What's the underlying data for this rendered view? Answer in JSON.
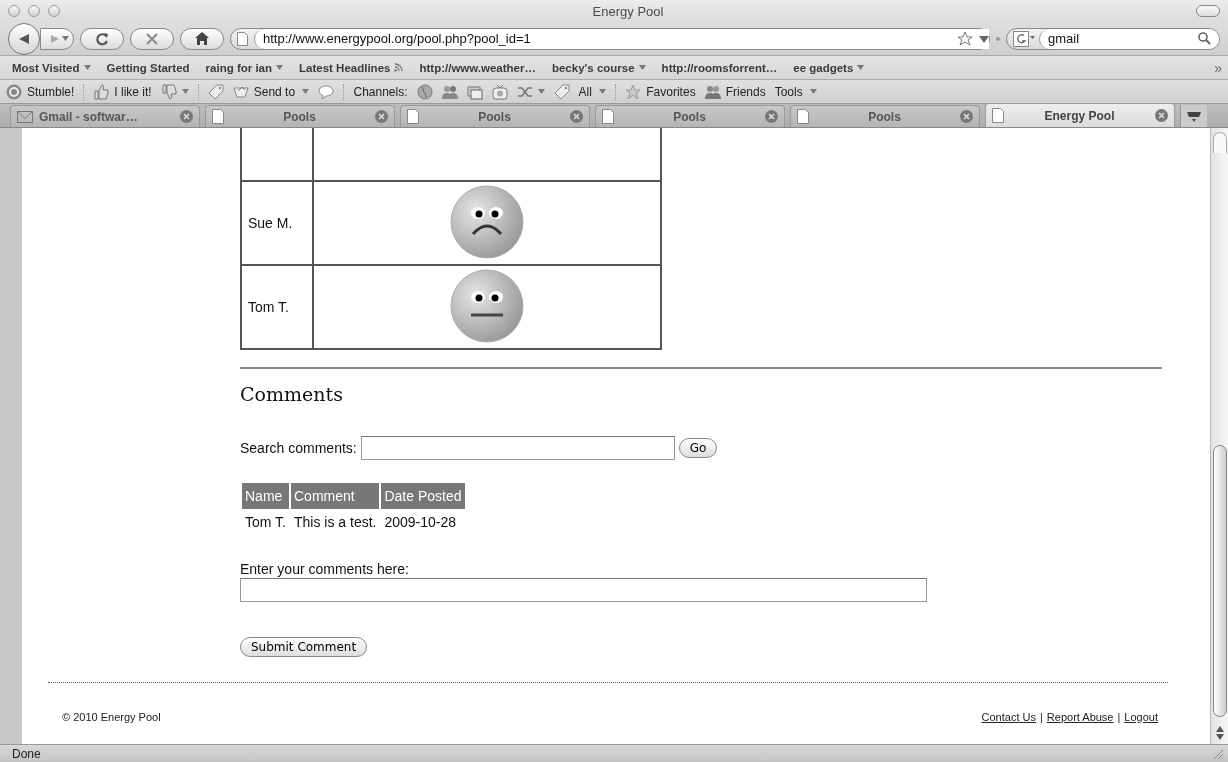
{
  "window": {
    "title": "Energy Pool"
  },
  "navigation": {
    "url": "http://www.energypool.org/pool.php?pool_id=1",
    "search_value": "gmail"
  },
  "bookmarks": {
    "items": [
      {
        "label": "Most Visited",
        "kind": "menu"
      },
      {
        "label": "Getting Started",
        "kind": "link"
      },
      {
        "label": "raing for ian",
        "kind": "menu"
      },
      {
        "label": "Latest Headlines",
        "kind": "feed"
      },
      {
        "label": "http://www.weather…",
        "kind": "link"
      },
      {
        "label": "becky's course",
        "kind": "menu"
      },
      {
        "label": "http://roomsforrent…",
        "kind": "link"
      },
      {
        "label": "ee gadgets",
        "kind": "menu"
      }
    ],
    "overflow": "»"
  },
  "stumble_toolbar": [
    {
      "kind": "stumble",
      "label": "Stumble!"
    },
    {
      "kind": "separator"
    },
    {
      "kind": "like",
      "label": "I like it!"
    },
    {
      "kind": "dislike"
    },
    {
      "kind": "separator"
    },
    {
      "kind": "tag"
    },
    {
      "kind": "send",
      "label": "Send to"
    },
    {
      "kind": "comment"
    },
    {
      "kind": "separator"
    },
    {
      "kind": "channels",
      "label": "Channels:"
    },
    {
      "kind": "globe"
    },
    {
      "kind": "people"
    },
    {
      "kind": "photo"
    },
    {
      "kind": "tv"
    },
    {
      "kind": "shuffle"
    },
    {
      "kind": "tag"
    },
    {
      "kind": "all",
      "label": "All"
    },
    {
      "kind": "separator"
    },
    {
      "kind": "favorites",
      "label": "Favorites"
    },
    {
      "kind": "friends",
      "label": "Friends"
    },
    {
      "kind": "tools",
      "label": "Tools"
    }
  ],
  "tabs": [
    {
      "label": "Gmail - softwar…",
      "kind": "mail",
      "selected": false
    },
    {
      "label": "Pools",
      "kind": "page",
      "selected": false
    },
    {
      "label": "Pools",
      "kind": "page",
      "selected": false
    },
    {
      "label": "Pools",
      "kind": "page",
      "selected": false
    },
    {
      "label": "Pools",
      "kind": "page",
      "selected": false
    },
    {
      "label": "Energy Pool",
      "kind": "page",
      "selected": true
    }
  ],
  "ratings": {
    "rows": [
      {
        "name": "Sue M.",
        "kind": "sad"
      },
      {
        "name": "Tom T.",
        "kind": "neutral"
      }
    ]
  },
  "comments": {
    "heading": "Comments",
    "search_label": "Search comments:",
    "search_button": "Go",
    "columns": [
      "Name",
      "Comment",
      "Date Posted"
    ],
    "rows": [
      [
        "Tom T.",
        "This is a test.",
        "2009-10-28"
      ]
    ],
    "entry_label": "Enter your comments here:",
    "submit_button": "Submit Comment"
  },
  "footer": {
    "copyright": "© 2010 Energy Pool",
    "links": [
      "Contact Us",
      "Report Abuse",
      "Logout"
    ],
    "separator": "|"
  },
  "status_bar": {
    "text": "Done"
  }
}
